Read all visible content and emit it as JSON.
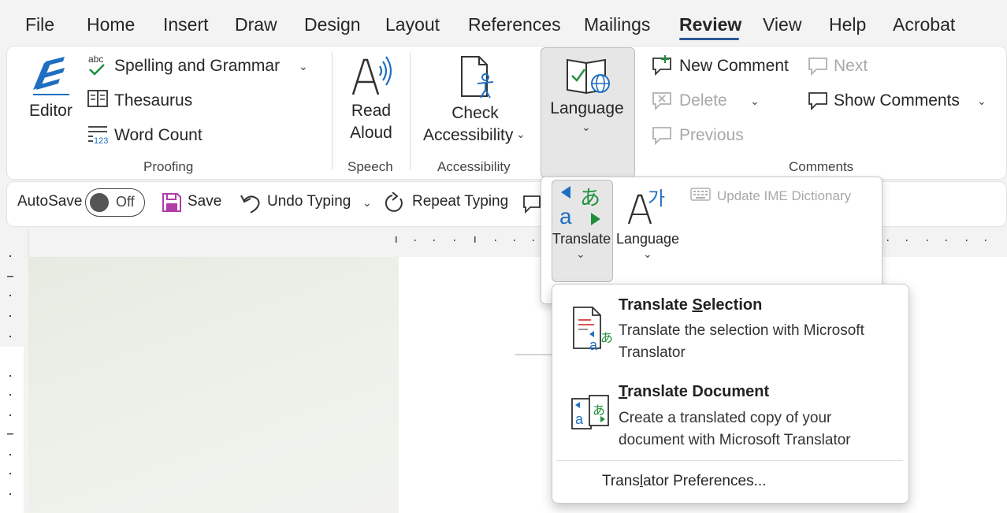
{
  "menu": {
    "tabs": [
      "File",
      "Home",
      "Insert",
      "Draw",
      "Design",
      "Layout",
      "References",
      "Mailings",
      "Review",
      "View",
      "Help",
      "Acrobat"
    ],
    "active_tab": "Review"
  },
  "ribbon": {
    "proofing": {
      "editor_label": "Editor",
      "spelling_label": "Spelling and Grammar",
      "thesaurus_label": "Thesaurus",
      "word_count_label": "Word Count",
      "group_label": "Proofing",
      "spelling_icon_text": "abc",
      "word_count_icon_text": "123"
    },
    "speech": {
      "read_label_1": "Read",
      "read_label_2": "Aloud",
      "group_label": "Speech"
    },
    "accessibility": {
      "check_label_1": "Check",
      "check_label_2": "Accessibility",
      "group_label": "Accessibility"
    },
    "language": {
      "label": "Language"
    },
    "comments": {
      "new_comment_label": "New Comment",
      "delete_label": "Delete",
      "previous_label": "Previous",
      "next_label": "Next",
      "show_comments_label": "Show Comments",
      "group_label": "Comments"
    }
  },
  "qat": {
    "autosave_label": "AutoSave",
    "autosave_state": "Off",
    "save_label": "Save",
    "undo_label": "Undo Typing",
    "repeat_label": "Repeat Typing"
  },
  "language_flyout": {
    "translate_label": "Translate",
    "language_label": "Language",
    "update_ime_label": "Update IME Dictionary"
  },
  "translate_menu": {
    "selection_title_pre": "Translate ",
    "selection_title_accel": "S",
    "selection_title_post": "election",
    "selection_desc": "Translate the selection with Microsoft Translator",
    "document_title_accel": "T",
    "document_title_post": "ranslate Document",
    "document_desc": "Create a translated copy of your document with Microsoft Translator",
    "prefs_pre": "Trans",
    "prefs_accel": "l",
    "prefs_post": "ator Preferences..."
  },
  "colors": {
    "accent": "#2b5797",
    "translate_blue": "#1f6fc1",
    "translate_green": "#1f8f3a"
  }
}
